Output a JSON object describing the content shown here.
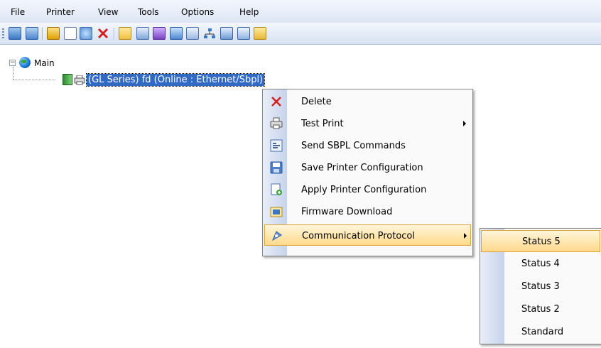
{
  "menubar": {
    "items": [
      "File",
      "Printer",
      "View",
      "Tools",
      "Options",
      "Help"
    ]
  },
  "toolbar": {
    "icons": [
      "add-printer-icon",
      "printer-settings-icon",
      "printer-icon",
      "page-icon",
      "search-icon",
      "delete-icon",
      "folder-icon",
      "chart-icon",
      "refresh-icon",
      "picture-icon",
      "commands-icon",
      "network-icon",
      "save-icon",
      "monitor-icon",
      "download-icon"
    ]
  },
  "tree": {
    "root_label": "Main",
    "node_label": "(GL Series) fd (Online : Ethernet/Sbpl)"
  },
  "context_menu": {
    "items": [
      {
        "label": "Delete",
        "icon": "delete-icon"
      },
      {
        "label": "Test Print",
        "icon": "printer-icon",
        "has_submenu": true
      },
      {
        "label": "Send SBPL Commands",
        "icon": "commands-icon"
      },
      {
        "label": "Save Printer Configuration",
        "icon": "save-icon"
      },
      {
        "label": "Apply Printer Configuration",
        "icon": "apply-config-icon"
      },
      {
        "label": "Firmware Download",
        "icon": "download-icon"
      },
      {
        "label": "Communication Protocol",
        "icon": "protocol-icon",
        "has_submenu": true,
        "highlighted": true
      }
    ]
  },
  "submenu": {
    "items": [
      "Status 5",
      "Status 4",
      "Status 3",
      "Status 2",
      "Standard"
    ],
    "highlighted": "Status 5"
  },
  "colors": {
    "selection": "#316ac5",
    "highlight": "#ffd98c",
    "accent_red": "#d42020"
  }
}
